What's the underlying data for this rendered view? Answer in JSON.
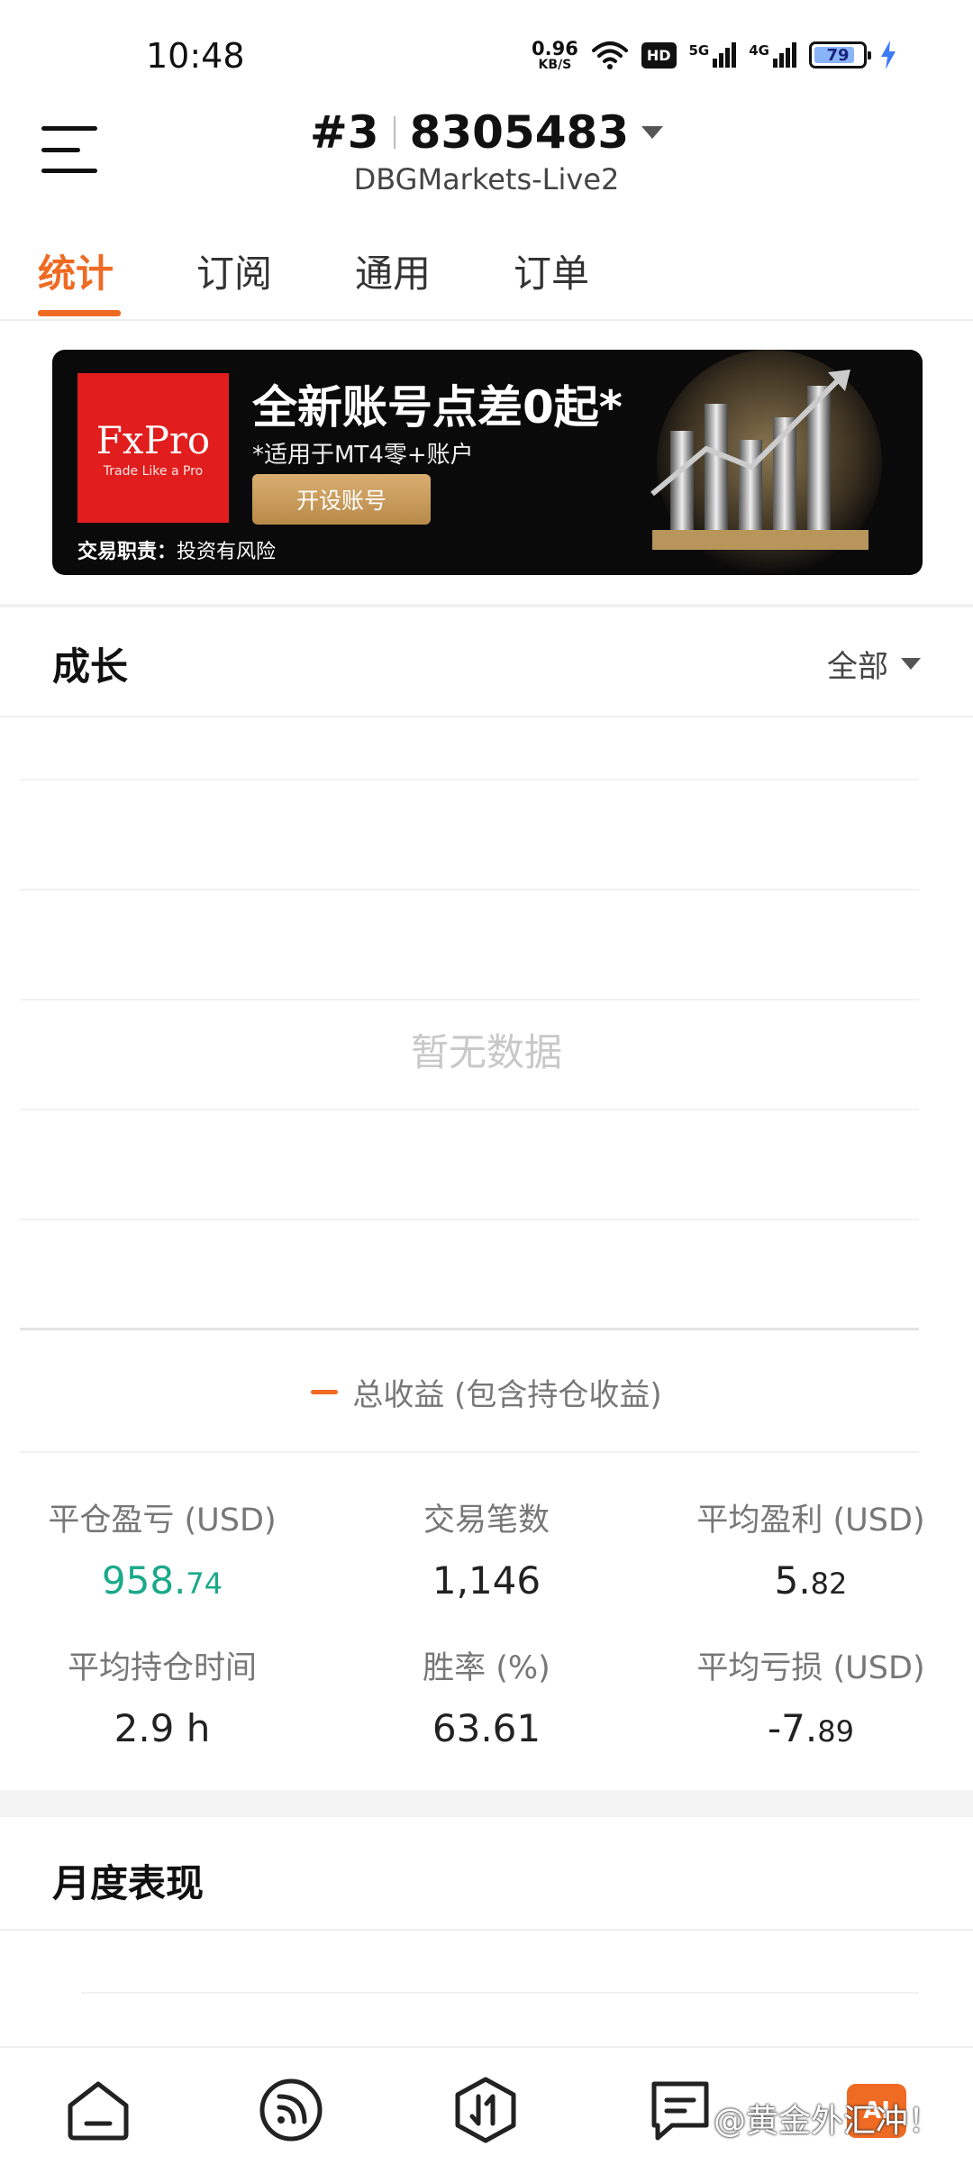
{
  "status_bar": {
    "time": "10:48",
    "net_speed_value": "0.96",
    "net_speed_unit": "KB/S",
    "hd_badge": "HD",
    "sim1_label": "5G",
    "sim2_label": "4G",
    "battery_percent": "79"
  },
  "header": {
    "account_prefix": "#3",
    "account_number": "8305483",
    "server": "DBGMarkets-Live2"
  },
  "tabs": [
    {
      "label": "统计",
      "active": true
    },
    {
      "label": "订阅",
      "active": false
    },
    {
      "label": "通用",
      "active": false
    },
    {
      "label": "订单",
      "active": false
    }
  ],
  "banner": {
    "logo_name": "FxPro",
    "logo_tagline": "Trade Like a Pro",
    "headline": "全新账号点差0起*",
    "subline": "*适用于MT4零+账户",
    "button": "开设账号",
    "risk_label": "交易职责：",
    "risk_text": "投资有风险"
  },
  "growth": {
    "title": "成长",
    "filter": "全部",
    "empty": "暂无数据",
    "legend": "总收益 (包含持仓收益)"
  },
  "stats": [
    {
      "label": "平仓盈亏 (USD)",
      "int": "958.",
      "dec": "74",
      "color": "green"
    },
    {
      "label": "交易笔数",
      "int": "1,146",
      "dec": "",
      "color": "normal"
    },
    {
      "label": "平均盈利 (USD)",
      "int": "5.",
      "dec": "82",
      "color": "normal"
    },
    {
      "label": "平均持仓时间",
      "int": "2.9 h",
      "dec": "",
      "color": "normal"
    },
    {
      "label": "胜率 (%)",
      "int": "63.61",
      "dec": "",
      "color": "normal"
    },
    {
      "label": "平均亏损 (USD)",
      "int": "-7.",
      "dec": "89",
      "color": "normal"
    }
  ],
  "monthly": {
    "title": "月度表现"
  },
  "bottom_nav": {
    "icons": [
      "home-icon",
      "subscribe-feed-icon",
      "trade-exchange-icon",
      "messages-icon"
    ],
    "badge_text": "AI",
    "watermark": "@黄金外汇冲！"
  },
  "colors": {
    "accent": "#ef6a22",
    "profit_green": "#1aa98a"
  }
}
